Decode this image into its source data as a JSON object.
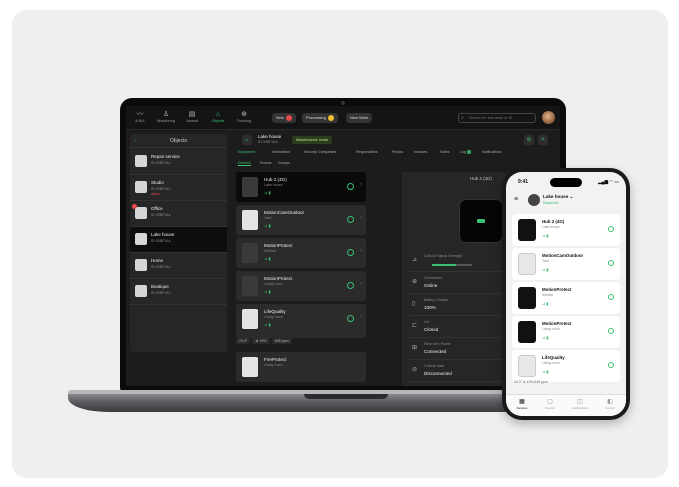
{
  "laptop": {
    "topbar": {
      "nav": [
        {
          "icon": "ajax-logo-icon",
          "glyph": "〰",
          "label": "AJAX"
        },
        {
          "icon": "monitoring-icon",
          "glyph": "♙",
          "label": "Monitoring"
        },
        {
          "icon": "journal-icon",
          "glyph": "▤",
          "label": "Journal"
        },
        {
          "icon": "objects-icon",
          "glyph": "⌂",
          "label": "Objects"
        },
        {
          "icon": "tracking-icon",
          "glyph": "⊕",
          "label": "Tracking"
        }
      ],
      "pills": [
        {
          "label": "New",
          "dot": "#e54b4b"
        },
        {
          "label": "Processing",
          "dot": "#f2c233"
        },
        {
          "label": "New Work"
        }
      ],
      "search_placeholder": "Search for full name or ID",
      "search_icon": "⌕"
    },
    "objects_panel": {
      "title": "Objects",
      "back_glyph": "‹",
      "items": [
        {
          "name": "Repair service",
          "id": "ID 00BF1A4",
          "alarm": ""
        },
        {
          "name": "Studio",
          "id": "ID 00BF1A4",
          "alarm": "Alarm"
        },
        {
          "name": "Office",
          "id": "ID 00BF1A4",
          "alarm": ""
        },
        {
          "name": "Lake house",
          "id": "ID 00BF1A4",
          "alarm": ""
        },
        {
          "name": "Home",
          "id": "ID 00BF1A4",
          "alarm": ""
        },
        {
          "name": "Boutique",
          "id": "ID 00BF1A4",
          "alarm": ""
        }
      ]
    },
    "object_header": {
      "title": "Lake house",
      "subtitle": "ID 00BF1A4",
      "mode": "Maintenance mode"
    },
    "tabs": [
      {
        "label": "Equipment",
        "active": true
      },
      {
        "label": "Information"
      },
      {
        "label": "Security Companies"
      },
      {
        "label": "Responsibles"
      },
      {
        "label": "Photos"
      },
      {
        "label": "Invoices"
      },
      {
        "label": "Notes"
      },
      {
        "label": "Log",
        "badge": "1"
      },
      {
        "label": "Notifications"
      }
    ],
    "subtabs": [
      {
        "label": "Devices",
        "active": true
      },
      {
        "label": "Rooms"
      },
      {
        "label": "Groups"
      }
    ],
    "devices": [
      {
        "name": "Hub 2 (4G)",
        "room": "Lake house",
        "status": "⊿ ▮",
        "thumb": "dark"
      },
      {
        "name": "MotionCamOutdoor",
        "room": "Yard",
        "status": "⊿ ▮",
        "thumb": "white"
      },
      {
        "name": "MotionProtect",
        "room": "Kitchen",
        "status": "⊿ ▮",
        "thumb": "dark"
      },
      {
        "name": "MotionProtect",
        "room": "Living room",
        "status": "⊿ ▮",
        "thumb": "dark"
      },
      {
        "name": "LifeQuality",
        "room": "Living room",
        "status": "⊿ ▮",
        "thumb": "white"
      },
      {
        "name": "FireProtect",
        "room": "Living room",
        "status": "",
        "thumb": "white"
      }
    ],
    "readings": [
      "24.3°",
      "⊚ 19%",
      "645 ppm"
    ],
    "hub_detail": {
      "title": "Hub 2 (4G)",
      "rows": [
        {
          "icon": "⊿",
          "label": "Cellular Signal Strength",
          "value": ""
        },
        {
          "icon": "⊕",
          "label": "Connection",
          "value": "Online"
        },
        {
          "icon": "▯",
          "label": "Battery Charge",
          "value": "100%"
        },
        {
          "icon": "⊏",
          "label": "Lid",
          "value": "Closed"
        },
        {
          "icon": "⊞",
          "label": "Ethernet / Power",
          "value": "Connected"
        },
        {
          "icon": "⊘",
          "label": "Cellular data",
          "value": "Disconnected"
        }
      ]
    }
  },
  "phone": {
    "time": "9:41",
    "status_icons": "▂▄▆ ◠ ▭",
    "header": {
      "menu_glyph": "≡",
      "title": "Lake house ⌄",
      "subtitle": "Disarmed"
    },
    "devices": [
      {
        "name": "Hub 2 (4G)",
        "room": "Lake house",
        "status": "⊿ ▮",
        "thumb": "dark"
      },
      {
        "name": "MotionCamOutdoor",
        "room": "Yard",
        "status": "⊿ ▮",
        "thumb": "white"
      },
      {
        "name": "MotionProtect",
        "room": "Kitchen",
        "status": "⊿ ▮",
        "thumb": "dark"
      },
      {
        "name": "MotionProtect",
        "room": "Living room",
        "status": "⊿ ▮",
        "thumb": "dark"
      },
      {
        "name": "LifeQuality",
        "room": "Living room",
        "status": "⊿ ▮",
        "thumb": "white"
      }
    ],
    "readings": "24.3°   ⊚ 19%   645 ppm",
    "tabs": [
      {
        "glyph": "▦",
        "label": "Devices",
        "active": true
      },
      {
        "glyph": "▢",
        "label": "Rooms"
      },
      {
        "glyph": "◫",
        "label": "Notifications"
      },
      {
        "glyph": "◧",
        "label": "Control"
      }
    ]
  },
  "colors": {
    "accent": "#38c172",
    "alarm": "#e54b4b",
    "warning": "#f2c233"
  }
}
